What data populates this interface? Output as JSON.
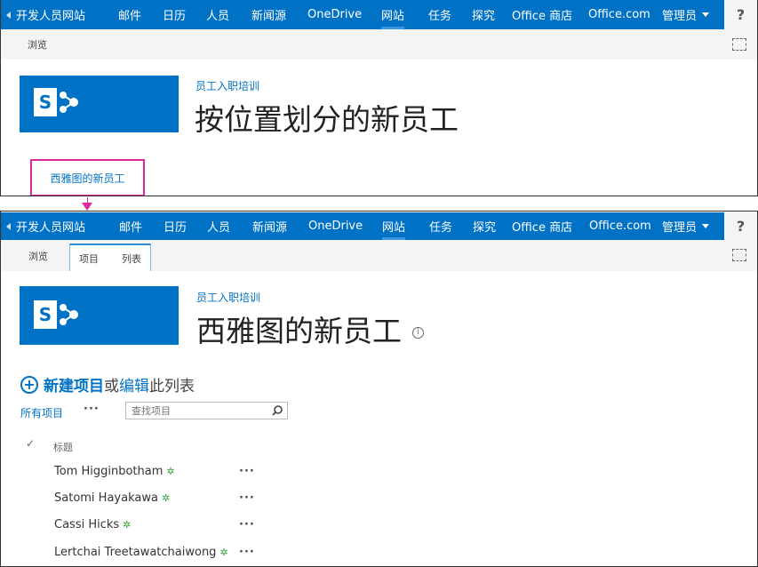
{
  "suitebar": {
    "back_label": "开发人员网站",
    "links": [
      "邮件",
      "日历",
      "人员",
      "新闻源",
      "OneDrive",
      "网站",
      "任务",
      "探究",
      "Office 商店",
      "Office.com",
      "管理员"
    ],
    "help": "?"
  },
  "panel1": {
    "ribbon_tab": "浏览",
    "breadcrumb": "员工入职培训",
    "title": "按位置划分的新员工",
    "highlighted_link": "西雅图的新员工"
  },
  "panel2": {
    "ribbon_tabs": [
      "浏览",
      "项目",
      "列表"
    ],
    "breadcrumb": "员工入职培训",
    "title": "西雅图的新员工",
    "new_item": {
      "new": "新建项目",
      "or": "或",
      "edit": "编辑",
      "rest": "此列表"
    },
    "all_items": "所有项目",
    "search_placeholder": "查找项目",
    "column_title": "标题",
    "rows": [
      "Tom Higginbotham",
      "Satomi Hayakawa",
      "Cassi Hicks",
      "Lertchai Treetawatchaiwong"
    ]
  },
  "colors": {
    "suitebar": "#0072c6",
    "highlight": "#e0299a"
  }
}
